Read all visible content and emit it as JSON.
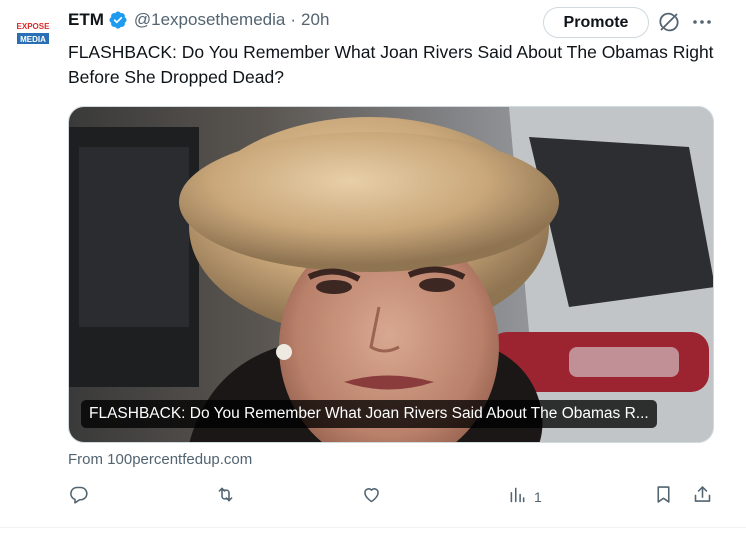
{
  "author": {
    "avatar_text_top": "EXPOSE",
    "avatar_text_bottom": "MEDIA",
    "name": "ETM",
    "handle": "@1exposethemedia",
    "separator": "·",
    "time": "20h",
    "verified_icon": "verified-badge-icon"
  },
  "header_actions": {
    "promote_label": "Promote",
    "grok_icon": "grok-icon",
    "more_icon": "more-icon"
  },
  "tweet": {
    "text": "FLASHBACK: Do You Remember What Joan Rivers Said About The Obamas Right Before She Dropped Dead?"
  },
  "card": {
    "title": "FLASHBACK: Do You Remember What Joan Rivers Said About The Obamas R...",
    "source": "From 100percentfedup.com"
  },
  "actions": {
    "reply_icon": "reply-icon",
    "retweet_icon": "retweet-icon",
    "like_icon": "like-icon",
    "views_icon": "views-icon",
    "views_count": "1",
    "bookmark_icon": "bookmark-icon",
    "share_icon": "share-icon"
  },
  "colors": {
    "text_primary": "#0f1419",
    "text_secondary": "#536471",
    "verified_blue": "#1d9bf0",
    "border": "#cfd9de"
  }
}
